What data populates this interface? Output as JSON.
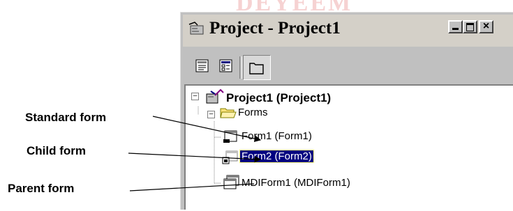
{
  "watermark": "DEYEEM",
  "window": {
    "title": "Project - Project1",
    "buttons": {
      "minimize": "_",
      "maximize": "□",
      "close": "×"
    },
    "toolbar": [
      "view-code",
      "view-object",
      "toggle-folders"
    ]
  },
  "tree": {
    "root": "Project1 (Project1)",
    "folder": "Forms",
    "items": [
      {
        "label": "Form1 (Form1)",
        "selected": false
      },
      {
        "label": "Form2 (Form2)",
        "selected": true
      },
      {
        "label": "MDIForm1 (MDIForm1)",
        "selected": false
      }
    ]
  },
  "callouts": {
    "standard": "Standard form",
    "child": "Child form",
    "parent": "Parent form"
  },
  "colors": {
    "selection": "#000080",
    "window_face": "#c0c0c0"
  }
}
